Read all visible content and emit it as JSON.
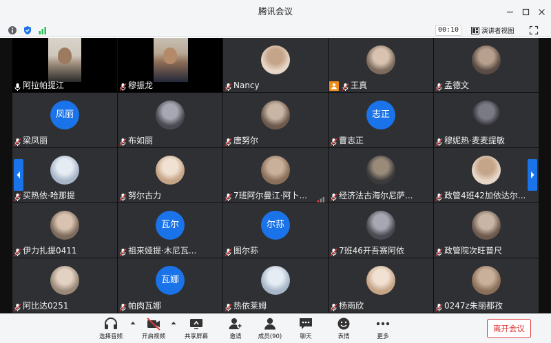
{
  "app": {
    "title": "腾讯会议"
  },
  "status": {
    "timer": "00:10",
    "speaker_view_label": "演讲者视图"
  },
  "participants": [
    {
      "name": "阿拉帕提江",
      "tile": "video"
    },
    {
      "name": "穆振龙",
      "tile": "video"
    },
    {
      "name": "Nancy",
      "tile": "avatar"
    },
    {
      "name": "王真",
      "tile": "avatar",
      "host": true
    },
    {
      "name": "孟德文",
      "tile": "avatar"
    },
    {
      "name": "梁凤丽",
      "tile": "text",
      "avatar_text": "凤丽"
    },
    {
      "name": "布如丽",
      "tile": "avatar"
    },
    {
      "name": "唐努尔",
      "tile": "avatar"
    },
    {
      "name": "曹志正",
      "tile": "text",
      "avatar_text": "志正"
    },
    {
      "name": "穆妮热·麦麦提敏",
      "tile": "avatar"
    },
    {
      "name": "买热依·哈那提",
      "tile": "avatar"
    },
    {
      "name": "努尔古力",
      "tile": "avatar"
    },
    {
      "name": "7班阿尔曼江·阿卜...",
      "tile": "avatar"
    },
    {
      "name": "经济法古海尔尼萨...",
      "tile": "avatar"
    },
    {
      "name": "政管4班42加依达尔...",
      "tile": "avatar"
    },
    {
      "name": "伊力扎提0411",
      "tile": "avatar"
    },
    {
      "name": "祖来娅提·木尼瓦...",
      "tile": "text",
      "avatar_text": "瓦尔"
    },
    {
      "name": "图尔荪",
      "tile": "text",
      "avatar_text": "尔荪"
    },
    {
      "name": "7班46开吾赛阿依",
      "tile": "avatar"
    },
    {
      "name": "政管院次旺普尺",
      "tile": "avatar"
    },
    {
      "name": "阿比达0251",
      "tile": "avatar"
    },
    {
      "name": "帕肉瓦娜",
      "tile": "text",
      "avatar_text": "瓦娜"
    },
    {
      "name": "热依莱姆",
      "tile": "avatar"
    },
    {
      "name": "杨雨欣",
      "tile": "avatar"
    },
    {
      "name": "0247z朱丽都孜",
      "tile": "avatar"
    }
  ],
  "toolbar": {
    "audio_label": "选择音频",
    "video_label": "开启视频",
    "share_label": "共享屏幕",
    "invite_label": "邀请",
    "members_label": "成员(90)",
    "chat_label": "聊天",
    "reactions_label": "表情",
    "more_label": "更多",
    "leave_label": "离开会议"
  },
  "colors": {
    "accent": "#1a73e8",
    "danger": "#e03a3a",
    "host_badge": "#f08c1a",
    "tile_bg": "#2f3033"
  }
}
